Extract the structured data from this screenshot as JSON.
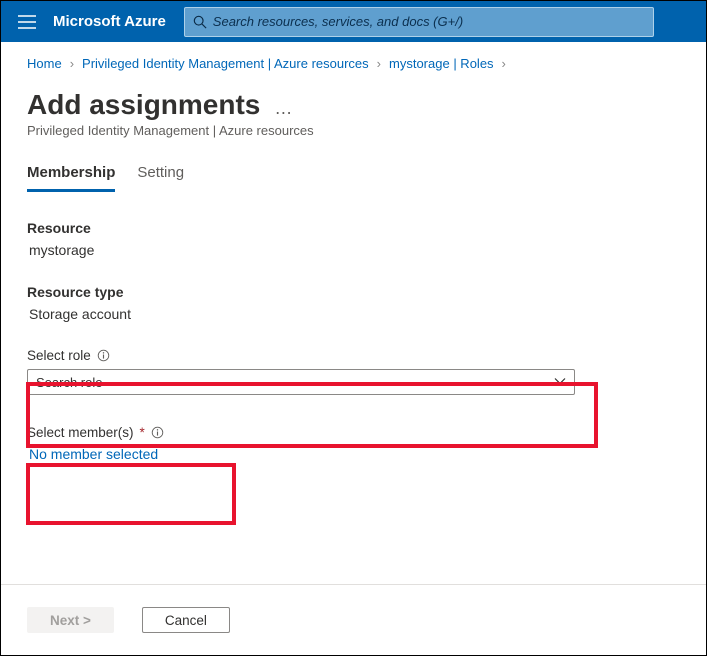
{
  "header": {
    "brand": "Microsoft Azure",
    "search_placeholder": "Search resources, services, and docs (G+/)"
  },
  "breadcrumb": {
    "items": [
      "Home",
      "Privileged Identity Management | Azure resources",
      "mystorage | Roles"
    ]
  },
  "page": {
    "title": "Add assignments",
    "subtitle": "Privileged Identity Management | Azure resources"
  },
  "tabs": {
    "items": [
      {
        "label": "Membership",
        "active": true
      },
      {
        "label": "Setting",
        "active": false
      }
    ]
  },
  "form": {
    "resource_label": "Resource",
    "resource_value": "mystorage",
    "resource_type_label": "Resource type",
    "resource_type_value": "Storage account",
    "select_role_label": "Select role",
    "select_role_placeholder": "Search role",
    "select_members_label": "Select member(s)",
    "no_member_text": "No member selected"
  },
  "footer": {
    "next": "Next >",
    "cancel": "Cancel"
  }
}
